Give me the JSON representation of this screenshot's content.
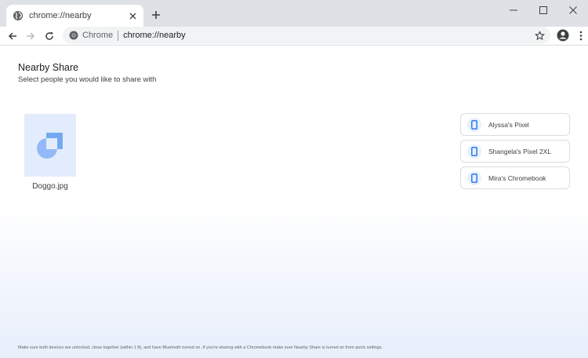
{
  "tab": {
    "title": "chrome://nearby",
    "favicon": "globe-icon"
  },
  "toolbar": {
    "chip_label": "Chrome",
    "url": "chrome://nearby"
  },
  "page": {
    "title": "Nearby Share",
    "subtitle": "Select people you would like to share with",
    "file": {
      "name": "Doggo.jpg"
    },
    "devices": [
      {
        "name": "Alyssa's Pixel"
      },
      {
        "name": "Shangela's Pixel 2XL"
      },
      {
        "name": "Mira's Chromebook"
      }
    ],
    "footer_note": "Make sure both devices are unlocked, close together (within 1 ft), and have Bluetooth turned on. If you're sharing with a Chromebook make sure Nearby Share is turned on from quick settings."
  },
  "colors": {
    "accent": "#1a73e8",
    "accent_light": "#8ab4f8",
    "thumb_bg": "#e3ecfc",
    "tabstrip_bg": "#dee1e6"
  }
}
